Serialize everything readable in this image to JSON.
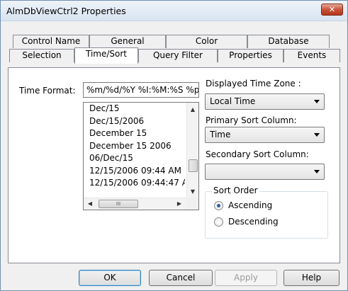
{
  "window": {
    "title": "AlmDbViewCtrl2 Properties",
    "close_glyph": "✕"
  },
  "tabs_back": [
    "Control Name",
    "General",
    "Color",
    "Database"
  ],
  "tabs_front": [
    "Selection",
    "Time/Sort",
    "Query Filter",
    "Properties",
    "Events"
  ],
  "active_tab": "Time/Sort",
  "time_format": {
    "label": "Time Format:",
    "value": "%m/%d/%Y %I:%M:%S %p",
    "options": [
      "Dec/15",
      "Dec/15/2006",
      "December 15",
      "December 15 2006",
      "06/Dec/15",
      "12/15/2006 09:44 AM",
      "12/15/2006 09:44:47 A"
    ]
  },
  "displayed_time_zone": {
    "label": "Displayed Time Zone :",
    "value": "Local Time"
  },
  "primary_sort": {
    "label": "Primary Sort Column:",
    "value": "Time"
  },
  "secondary_sort": {
    "label": "Secondary Sort Column:",
    "value": ""
  },
  "sort_order": {
    "label": "Sort Order",
    "options": [
      {
        "label": "Ascending",
        "checked": true
      },
      {
        "label": "Descending",
        "checked": false
      }
    ]
  },
  "scrollbar": {
    "up": "▲",
    "down": "▼",
    "left": "◀",
    "right": "▶",
    "grip": "III"
  },
  "buttons": {
    "ok": "OK",
    "cancel": "Cancel",
    "apply": "Apply",
    "help": "Help"
  }
}
